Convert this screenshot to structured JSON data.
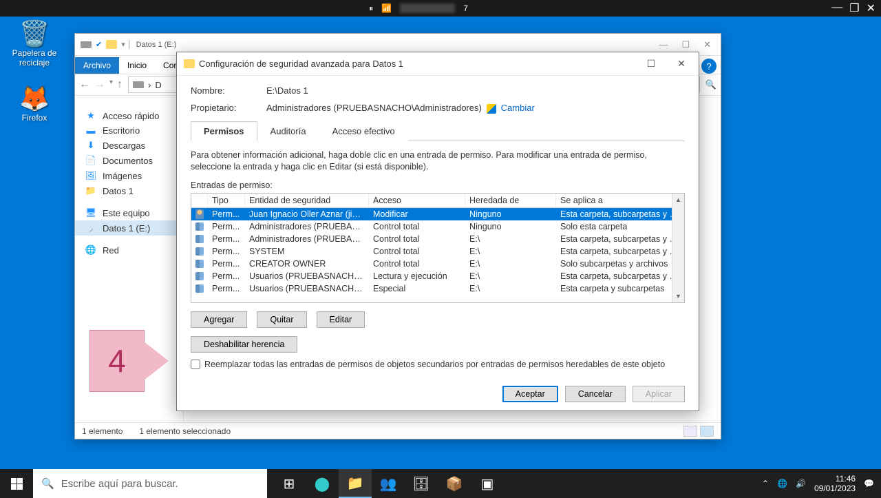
{
  "topBar": {
    "center": "7",
    "pauseIcon": "⏸",
    "signalIcon": "📶"
  },
  "desktopIcons": {
    "recycleBin": {
      "label": "Papelera de reciclaje",
      "glyph": "🗑️"
    },
    "firefox": {
      "label": "Firefox",
      "glyph": "🦊"
    }
  },
  "explorer": {
    "title": "Datos 1 (E:)",
    "ribbonTabs": {
      "archivo": "Archivo",
      "inicio": "Inicio",
      "compartir": "Compa"
    },
    "addressPath": "D",
    "sidebar": {
      "quickAccess": "Acceso rápido",
      "desktop": "Escritorio",
      "downloads": "Descargas",
      "documents": "Documentos",
      "pictures": "Imágenes",
      "datos1": "Datos 1",
      "thisPc": "Este equipo",
      "datos1e": "Datos 1 (E:)",
      "network": "Red"
    },
    "statusBar": {
      "count": "1 elemento",
      "selected": "1 elemento seleccionado"
    }
  },
  "dialog": {
    "title": "Configuración de seguridad avanzada para Datos 1",
    "nameLabel": "Nombre:",
    "nameValue": "E:\\Datos 1",
    "ownerLabel": "Propietario:",
    "ownerValue": "Administradores (PRUEBASNACHO\\Administradores)",
    "changeLink": "Cambiar",
    "tabs": {
      "permisos": "Permisos",
      "auditoria": "Auditoría",
      "accesoEfectivo": "Acceso efectivo"
    },
    "instructions": "Para obtener información adicional, haga doble clic en una entrada de permiso. Para modificar una entrada de permiso, seleccione la entrada y haga clic en Editar (si está disponible).",
    "entriesLabel": "Entradas de permiso:",
    "headers": {
      "type": "Tipo",
      "entity": "Entidad de seguridad",
      "access": "Acceso",
      "inherited": "Heredada de",
      "applies": "Se aplica a"
    },
    "rows": [
      {
        "icon": "user",
        "type": "Perm...",
        "entity": "Juan Ignacio Oller Aznar (jioll...",
        "access": "Modificar",
        "inherited": "Ninguno",
        "applies": "Esta carpeta, subcarpetas y ar...",
        "selected": true
      },
      {
        "icon": "group",
        "type": "Perm...",
        "entity": "Administradores (PRUEBASN...",
        "access": "Control total",
        "inherited": "Ninguno",
        "applies": "Solo esta carpeta",
        "selected": false
      },
      {
        "icon": "group",
        "type": "Perm...",
        "entity": "Administradores (PRUEBASN...",
        "access": "Control total",
        "inherited": "E:\\",
        "applies": "Esta carpeta, subcarpetas y ar...",
        "selected": false
      },
      {
        "icon": "group",
        "type": "Perm...",
        "entity": "SYSTEM",
        "access": "Control total",
        "inherited": "E:\\",
        "applies": "Esta carpeta, subcarpetas y ar...",
        "selected": false
      },
      {
        "icon": "group",
        "type": "Perm...",
        "entity": "CREATOR OWNER",
        "access": "Control total",
        "inherited": "E:\\",
        "applies": "Solo subcarpetas y archivos",
        "selected": false
      },
      {
        "icon": "group",
        "type": "Perm...",
        "entity": "Usuarios (PRUEBASNACHO\\...",
        "access": "Lectura y ejecución",
        "inherited": "E:\\",
        "applies": "Esta carpeta, subcarpetas y ar...",
        "selected": false
      },
      {
        "icon": "group",
        "type": "Perm...",
        "entity": "Usuarios (PRUEBASNACHO\\...",
        "access": "Especial",
        "inherited": "E:\\",
        "applies": "Esta carpeta y subcarpetas",
        "selected": false
      }
    ],
    "buttons": {
      "add": "Agregar",
      "remove": "Quitar",
      "edit": "Editar",
      "disableInherit": "Deshabilitar herencia",
      "accept": "Aceptar",
      "cancel": "Cancelar",
      "apply": "Aplicar"
    },
    "replaceCheckbox": "Reemplazar todas las entradas de permisos de objetos secundarios por entradas de permisos heredables de este objeto"
  },
  "callout": {
    "number": "4"
  },
  "taskbar": {
    "searchPlaceholder": "Escribe aquí para buscar.",
    "clock": {
      "time": "11:46",
      "date": "09/01/2023"
    }
  }
}
